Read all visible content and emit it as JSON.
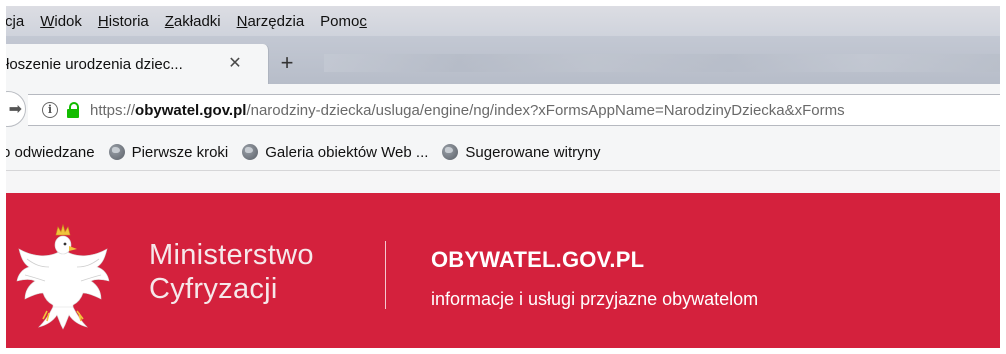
{
  "browser": {
    "menu": [
      {
        "pre": "cja",
        "ul": "",
        "post": ""
      },
      {
        "pre": "",
        "ul": "W",
        "post": "idok"
      },
      {
        "pre": "",
        "ul": "H",
        "post": "istoria"
      },
      {
        "pre": "",
        "ul": "Z",
        "post": "akładki"
      },
      {
        "pre": "",
        "ul": "N",
        "post": "arzędzia"
      },
      {
        "pre": "Pomo",
        "ul": "c",
        "post": ""
      }
    ],
    "tab": {
      "title": "łoszenie urodzenia dziec...",
      "close": "✕"
    },
    "new_tab": "+",
    "url": {
      "scheme": "https://",
      "host": "obywatel.gov.pl",
      "path": "/narodziny-dziecka/usluga/engine/ng/index?xFormsAppName=NarodzinyDziecka&xForms"
    },
    "bookmarks": [
      {
        "label": "o odwiedzane",
        "icon": ""
      },
      {
        "label": "Pierwsze kroki",
        "icon": "globe-icon"
      },
      {
        "label": "Galeria obiektów Web ...",
        "icon": "globe-icon"
      },
      {
        "label": "Sugerowane witryny",
        "icon": "globe-icon"
      }
    ]
  },
  "site": {
    "ministry_line1": "Ministerstwo",
    "ministry_line2": "Cyfryzacji",
    "portal_title": "OBYWATEL.GOV.PL",
    "portal_subtitle": "informacje i usługi przyjazne obywatelom",
    "brand_color": "#d4213d",
    "emblem": "polish-eagle-emblem"
  }
}
